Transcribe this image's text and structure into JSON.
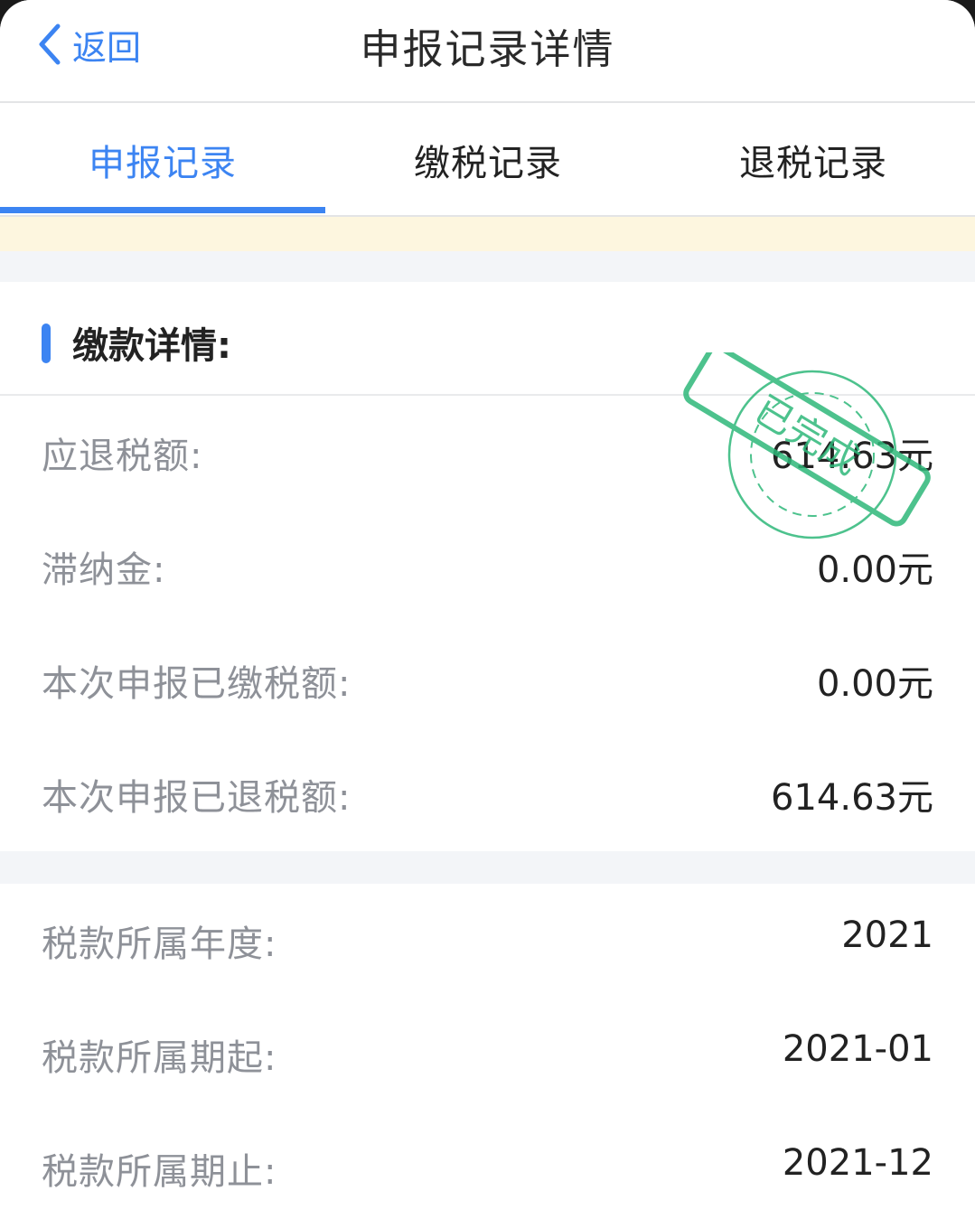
{
  "header": {
    "back_label": "返回",
    "title": "申报记录详情"
  },
  "tabs": [
    {
      "label": "申报记录",
      "active": true
    },
    {
      "label": "缴税记录",
      "active": false
    },
    {
      "label": "退税记录",
      "active": false
    }
  ],
  "section": {
    "title": "缴款详情:"
  },
  "payment_rows": [
    {
      "label": "应退税额:",
      "value": "614.63元"
    },
    {
      "label": "滞纳金:",
      "value": "0.00元"
    },
    {
      "label": "本次申报已缴税额:",
      "value": "0.00元"
    },
    {
      "label": "本次申报已退税额:",
      "value": "614.63元"
    }
  ],
  "period_rows": [
    {
      "label": "税款所属年度:",
      "value": "2021"
    },
    {
      "label": "税款所属期起:",
      "value": "2021-01"
    },
    {
      "label": "税款所属期止:",
      "value": "2021-12"
    }
  ],
  "stamp": {
    "text": "已完成",
    "color": "#2eb87a"
  },
  "colors": {
    "accent": "#3c84f2",
    "label_gray": "#8e9198",
    "notice_bg": "#fdf6df",
    "gap_bg": "#f3f5f8"
  },
  "icons": {
    "back": "chevron-left-icon"
  }
}
